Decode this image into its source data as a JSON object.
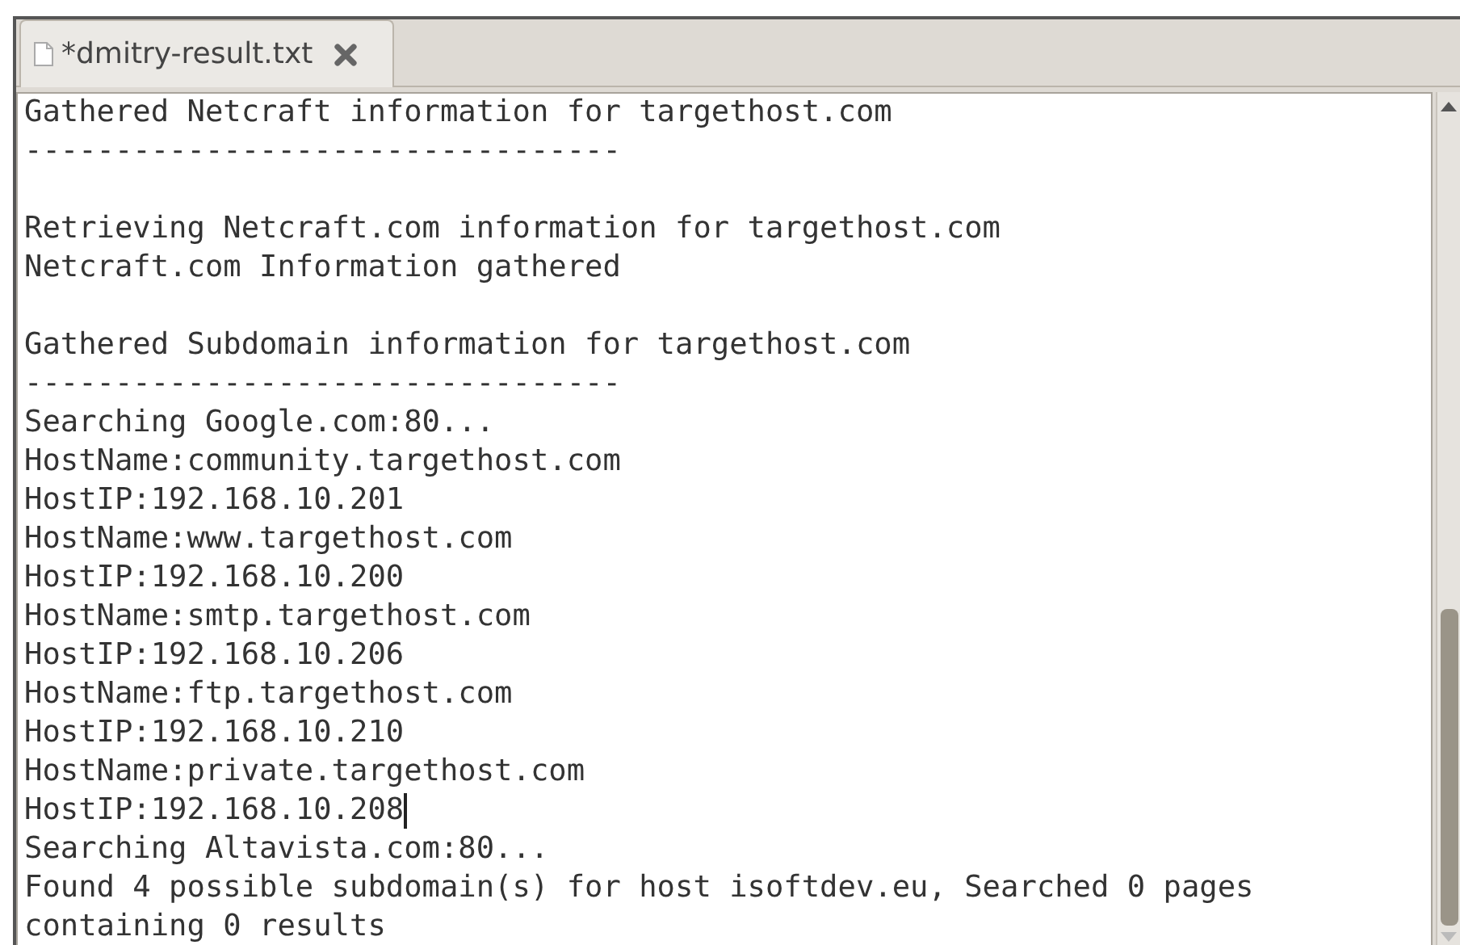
{
  "tabs": [
    {
      "label": "*dmitry-result.txt",
      "selected": true
    }
  ],
  "editor": {
    "lines": [
      {
        "kind": "text",
        "text": "Gathered Netcraft information for targethost.com",
        "cursor": false
      },
      {
        "kind": "text",
        "text": "---------------------------------",
        "cursor": false
      },
      {
        "kind": "blank"
      },
      {
        "kind": "text",
        "text": "Retrieving Netcraft.com information for targethost.com",
        "cursor": false
      },
      {
        "kind": "text",
        "text": "Netcraft.com Information gathered",
        "cursor": false
      },
      {
        "kind": "blank"
      },
      {
        "kind": "text",
        "text": "Gathered Subdomain information for targethost.com",
        "cursor": false
      },
      {
        "kind": "text",
        "text": "---------------------------------",
        "cursor": false
      },
      {
        "kind": "text",
        "text": "Searching Google.com:80...",
        "cursor": false
      },
      {
        "kind": "text",
        "text": "HostName:community.targethost.com",
        "cursor": false
      },
      {
        "kind": "text",
        "text": "HostIP:192.168.10.201",
        "cursor": false
      },
      {
        "kind": "text",
        "text": "HostName:www.targethost.com",
        "cursor": false
      },
      {
        "kind": "text",
        "text": "HostIP:192.168.10.200",
        "cursor": false
      },
      {
        "kind": "text",
        "text": "HostName:smtp.targethost.com",
        "cursor": false
      },
      {
        "kind": "text",
        "text": "HostIP:192.168.10.206",
        "cursor": false
      },
      {
        "kind": "text",
        "text": "HostName:ftp.targethost.com",
        "cursor": false
      },
      {
        "kind": "text",
        "text": "HostIP:192.168.10.210",
        "cursor": false
      },
      {
        "kind": "text",
        "text": "HostName:private.targethost.com",
        "cursor": false
      },
      {
        "kind": "text",
        "text": "HostIP:192.168.10.208",
        "cursor": true
      },
      {
        "kind": "text",
        "text": "Searching Altavista.com:80...",
        "cursor": false
      },
      {
        "kind": "text",
        "text": "Found 4 possible subdomain(s) for host isoftdev.eu, Searched 0 pages",
        "cursor": false
      },
      {
        "kind": "text",
        "text": "containing 0 results",
        "cursor": false
      }
    ]
  }
}
